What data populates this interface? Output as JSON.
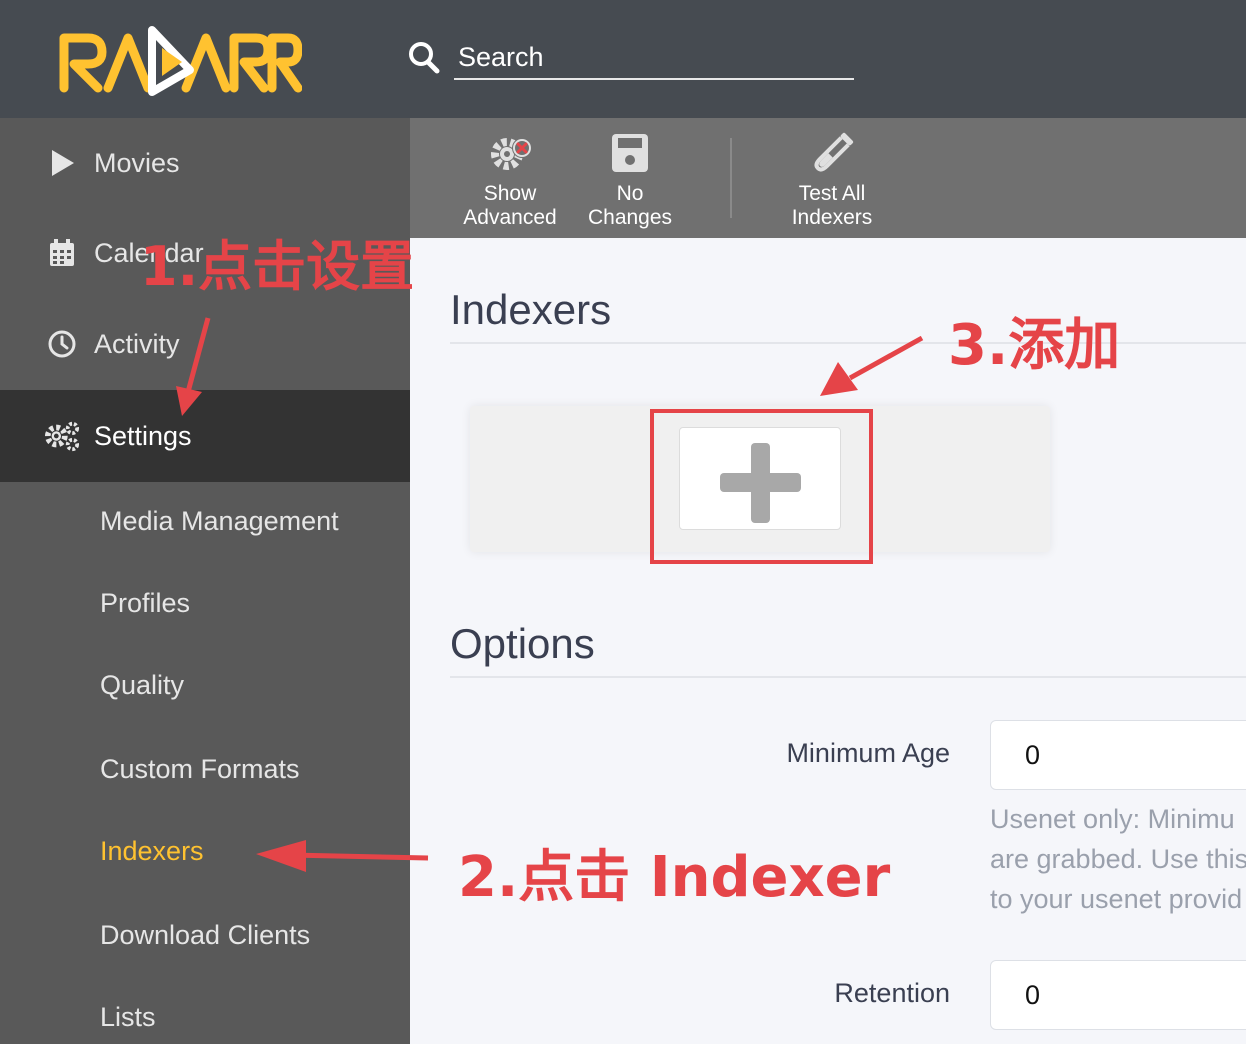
{
  "header": {
    "logo_text": "RADARR",
    "search_placeholder": "Search",
    "colors": {
      "bg": "#464b51",
      "logo": "#ffc230"
    }
  },
  "sidebar": {
    "items": [
      {
        "label": "Movies",
        "icon": "play-icon"
      },
      {
        "label": "Calendar",
        "icon": "calendar-icon"
      },
      {
        "label": "Activity",
        "icon": "clock-icon"
      },
      {
        "label": "Settings",
        "icon": "gears-icon",
        "active": true
      }
    ],
    "sub_items": [
      {
        "label": "Media Management"
      },
      {
        "label": "Profiles"
      },
      {
        "label": "Quality"
      },
      {
        "label": "Custom Formats"
      },
      {
        "label": "Indexers",
        "current": true
      },
      {
        "label": "Download Clients"
      },
      {
        "label": "Lists"
      }
    ]
  },
  "toolbar": {
    "show_advanced": {
      "line1": "Show",
      "line2": "Advanced",
      "icon": "gear-x-icon"
    },
    "no_changes": {
      "line1": "No",
      "line2": "Changes",
      "icon": "save-icon"
    },
    "test_all": {
      "line1": "Test All",
      "line2": "Indexers",
      "icon": "test-tube-icon"
    }
  },
  "main": {
    "indexers_title": "Indexers",
    "options_title": "Options",
    "minimum_age": {
      "label": "Minimum Age",
      "value": "0",
      "help": [
        "Usenet only: Minimu",
        "are grabbed. Use this",
        "to your usenet provid"
      ]
    },
    "retention": {
      "label": "Retention",
      "value": "0"
    }
  },
  "annotations": {
    "step1": "1.点击设置",
    "step2": "2.点击 Indexer",
    "step3": "3.添加",
    "color": "#e54448"
  }
}
